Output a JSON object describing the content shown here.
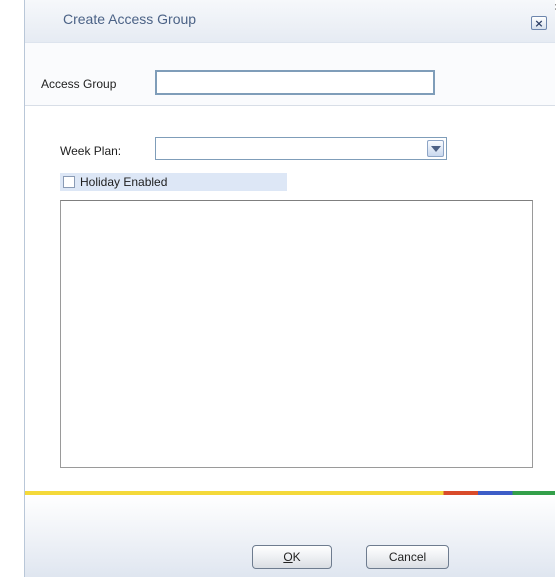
{
  "window": {
    "title": "Create Access Group",
    "close_glyph": "×",
    "corner_glyph": "×"
  },
  "form": {
    "access_group_label": "Access Group",
    "access_group_value": "",
    "week_plan_label": "Week Plan:",
    "week_plan_value": "",
    "holiday_label": "Holiday Enabled",
    "holiday_checked": false
  },
  "buttons": {
    "ok_mnemonic": "O",
    "ok_rest": "K",
    "cancel": "Cancel"
  },
  "colors": {
    "title": "#4b6286",
    "accent_yellow": "#f4d93a",
    "accent_red": "#d94b2a",
    "accent_blue": "#3d5dc7",
    "accent_green": "#33a04a"
  }
}
